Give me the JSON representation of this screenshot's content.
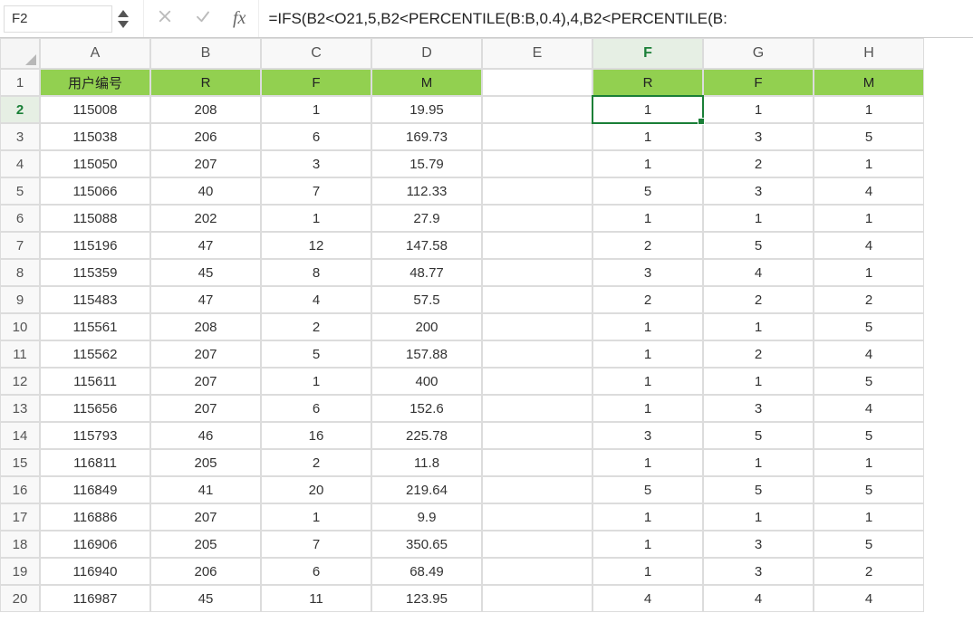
{
  "namebox": "F2",
  "formula": "=IFS(B2<O21,5,B2<PERCENTILE(B:B,0.4),4,B2<PERCENTILE(B:",
  "columns": [
    "A",
    "B",
    "C",
    "D",
    "E",
    "F",
    "G",
    "H"
  ],
  "rowCount": 20,
  "selected": {
    "col": "F",
    "row": 2
  },
  "headers": {
    "A": "用户编号",
    "B": "R",
    "C": "F",
    "D": "M",
    "E": "",
    "F": "R",
    "G": "F",
    "H": "M"
  },
  "greenCols": [
    "A",
    "B",
    "C",
    "D",
    "F",
    "G",
    "H"
  ],
  "rows": [
    {
      "A": "115008",
      "B": "208",
      "C": "1",
      "D": "19.95",
      "E": "",
      "F": "1",
      "G": "1",
      "H": "1"
    },
    {
      "A": "115038",
      "B": "206",
      "C": "6",
      "D": "169.73",
      "E": "",
      "F": "1",
      "G": "3",
      "H": "5"
    },
    {
      "A": "115050",
      "B": "207",
      "C": "3",
      "D": "15.79",
      "E": "",
      "F": "1",
      "G": "2",
      "H": "1"
    },
    {
      "A": "115066",
      "B": "40",
      "C": "7",
      "D": "112.33",
      "E": "",
      "F": "5",
      "G": "3",
      "H": "4"
    },
    {
      "A": "115088",
      "B": "202",
      "C": "1",
      "D": "27.9",
      "E": "",
      "F": "1",
      "G": "1",
      "H": "1"
    },
    {
      "A": "115196",
      "B": "47",
      "C": "12",
      "D": "147.58",
      "E": "",
      "F": "2",
      "G": "5",
      "H": "4"
    },
    {
      "A": "115359",
      "B": "45",
      "C": "8",
      "D": "48.77",
      "E": "",
      "F": "3",
      "G": "4",
      "H": "1"
    },
    {
      "A": "115483",
      "B": "47",
      "C": "4",
      "D": "57.5",
      "E": "",
      "F": "2",
      "G": "2",
      "H": "2"
    },
    {
      "A": "115561",
      "B": "208",
      "C": "2",
      "D": "200",
      "E": "",
      "F": "1",
      "G": "1",
      "H": "5"
    },
    {
      "A": "115562",
      "B": "207",
      "C": "5",
      "D": "157.88",
      "E": "",
      "F": "1",
      "G": "2",
      "H": "4"
    },
    {
      "A": "115611",
      "B": "207",
      "C": "1",
      "D": "400",
      "E": "",
      "F": "1",
      "G": "1",
      "H": "5"
    },
    {
      "A": "115656",
      "B": "207",
      "C": "6",
      "D": "152.6",
      "E": "",
      "F": "1",
      "G": "3",
      "H": "4"
    },
    {
      "A": "115793",
      "B": "46",
      "C": "16",
      "D": "225.78",
      "E": "",
      "F": "3",
      "G": "5",
      "H": "5"
    },
    {
      "A": "116811",
      "B": "205",
      "C": "2",
      "D": "11.8",
      "E": "",
      "F": "1",
      "G": "1",
      "H": "1"
    },
    {
      "A": "116849",
      "B": "41",
      "C": "20",
      "D": "219.64",
      "E": "",
      "F": "5",
      "G": "5",
      "H": "5"
    },
    {
      "A": "116886",
      "B": "207",
      "C": "1",
      "D": "9.9",
      "E": "",
      "F": "1",
      "G": "1",
      "H": "1"
    },
    {
      "A": "116906",
      "B": "205",
      "C": "7",
      "D": "350.65",
      "E": "",
      "F": "1",
      "G": "3",
      "H": "5"
    },
    {
      "A": "116940",
      "B": "206",
      "C": "6",
      "D": "68.49",
      "E": "",
      "F": "1",
      "G": "3",
      "H": "2"
    },
    {
      "A": "116987",
      "B": "45",
      "C": "11",
      "D": "123.95",
      "E": "",
      "F": "4",
      "G": "4",
      "H": "4"
    }
  ]
}
